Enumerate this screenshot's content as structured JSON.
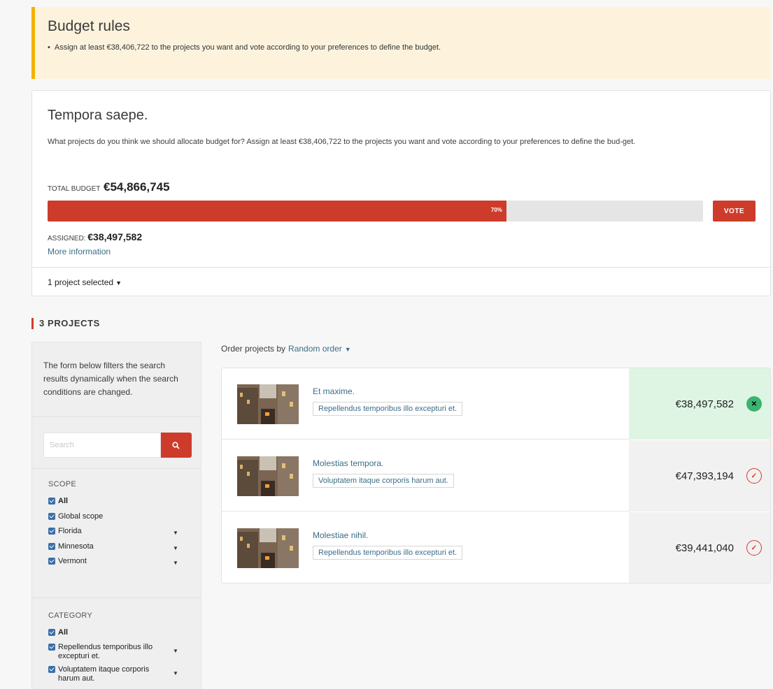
{
  "rules": {
    "title": "Budget rules",
    "item": "Assign at least €38,406,722 to the projects you want and vote according to your preferences to define the budget."
  },
  "budget": {
    "title": "Tempora saepe.",
    "description": "What projects do you think we should allocate budget for? Assign at least €38,406,722 to the projects you want and vote according to your preferences to define the bud-get.",
    "total_label": "Total budget",
    "total_value": "€54,866,745",
    "progress_percent": 70,
    "progress_label": "70%",
    "vote_label": "VOTE",
    "assigned_label": "Assigned:",
    "assigned_value": "€38,497,582",
    "more_info": "More information",
    "selected_label": "1 project selected"
  },
  "projects_header": "3 PROJECTS",
  "sidebar": {
    "intro": "The form below filters the search results dynamically when the search conditions are changed.",
    "search_placeholder": "Search",
    "scope": {
      "title": "SCOPE",
      "options": [
        "All",
        "Global scope",
        "Florida",
        "Minnesota",
        "Vermont"
      ]
    },
    "category": {
      "title": "CATEGORY",
      "options": [
        "All",
        "Repellendus temporibus illo excepturi et.",
        "Voluptatem itaque corporis harum aut."
      ]
    }
  },
  "order": {
    "label": "Order projects by",
    "value": "Random order"
  },
  "projects": [
    {
      "title": "Et maxime.",
      "category": "Repellendus temporibus illo excepturi et.",
      "amount": "€38,497,582",
      "selected": true
    },
    {
      "title": "Molestias tempora.",
      "category": "Voluptatem itaque corporis harum aut.",
      "amount": "€47,393,194",
      "selected": false
    },
    {
      "title": "Molestiae nihil.",
      "category": "Repellendus temporibus illo excepturi et.",
      "amount": "€39,441,040",
      "selected": false
    }
  ],
  "colors": {
    "accent": "#cd3c2b",
    "rules_bg": "#fdf3dd",
    "rules_border": "#f2b100",
    "link": "#3b6e85",
    "selected_bg": "#dff5e3",
    "remove_button": "#3cb371"
  },
  "icons": {
    "search": "search-icon",
    "remove": "close-icon",
    "add": "check-icon",
    "caret": "caret-down-icon",
    "chevron": "chevron-down-icon"
  }
}
